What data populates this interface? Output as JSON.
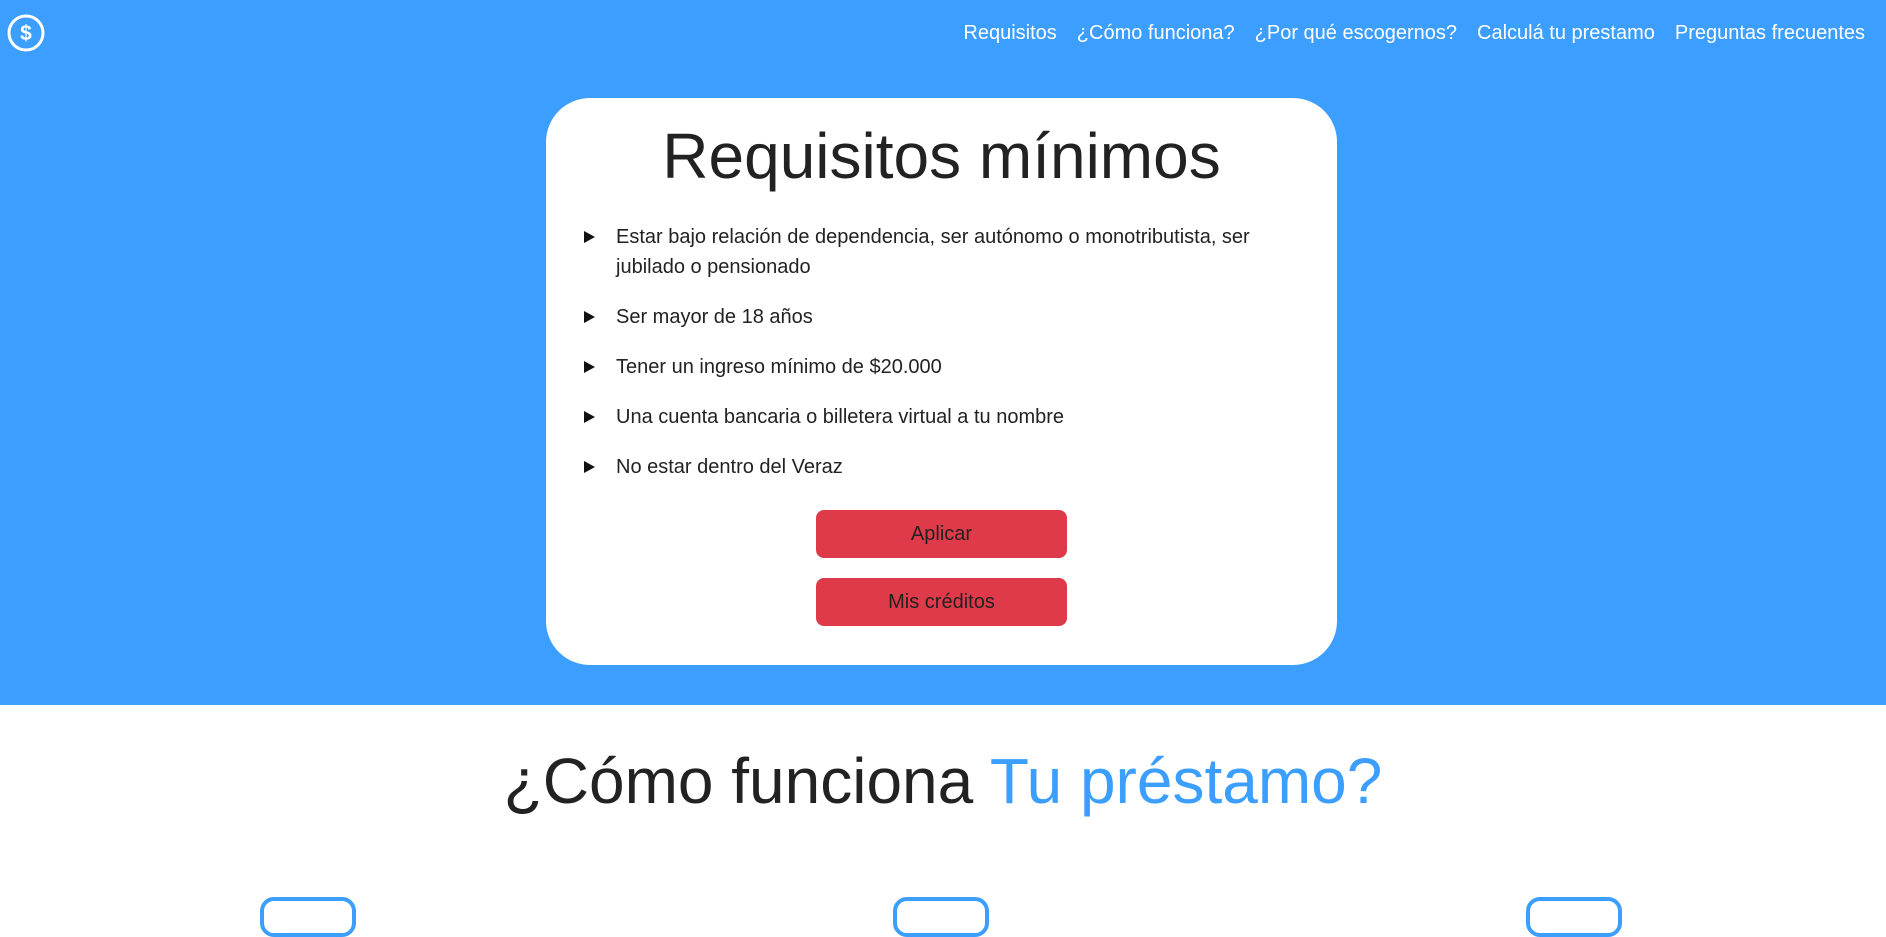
{
  "colors": {
    "hero_background": "#3c9efe",
    "accent": "#3c9efe",
    "button": "#df3a49",
    "text": "#222222"
  },
  "header": {
    "logo_icon": "dollar-circle-icon",
    "nav": [
      {
        "label": "Requisitos"
      },
      {
        "label": "¿Cómo funciona?"
      },
      {
        "label": "¿Por qué escogernos?"
      },
      {
        "label": "Calculá tu prestamo"
      },
      {
        "label": "Preguntas frecuentes"
      }
    ]
  },
  "requirements": {
    "title": "Requisitos mínimos",
    "items": [
      {
        "text": "Estar bajo relación de dependencia, ser autónomo o monotributista, ser jubilado o pensionado"
      },
      {
        "text": "Ser mayor de 18 años"
      },
      {
        "text": "Tener un ingreso mínimo de $20.000"
      },
      {
        "text": "Una cuenta bancaria o billetera virtual a tu nombre"
      },
      {
        "text": "No estar dentro del Veraz"
      }
    ],
    "apply_label": "Aplicar",
    "credits_label": "Mis créditos"
  },
  "how_it_works": {
    "title_prefix": "¿Cómo funciona ",
    "title_accent": "Tu préstamo?"
  }
}
